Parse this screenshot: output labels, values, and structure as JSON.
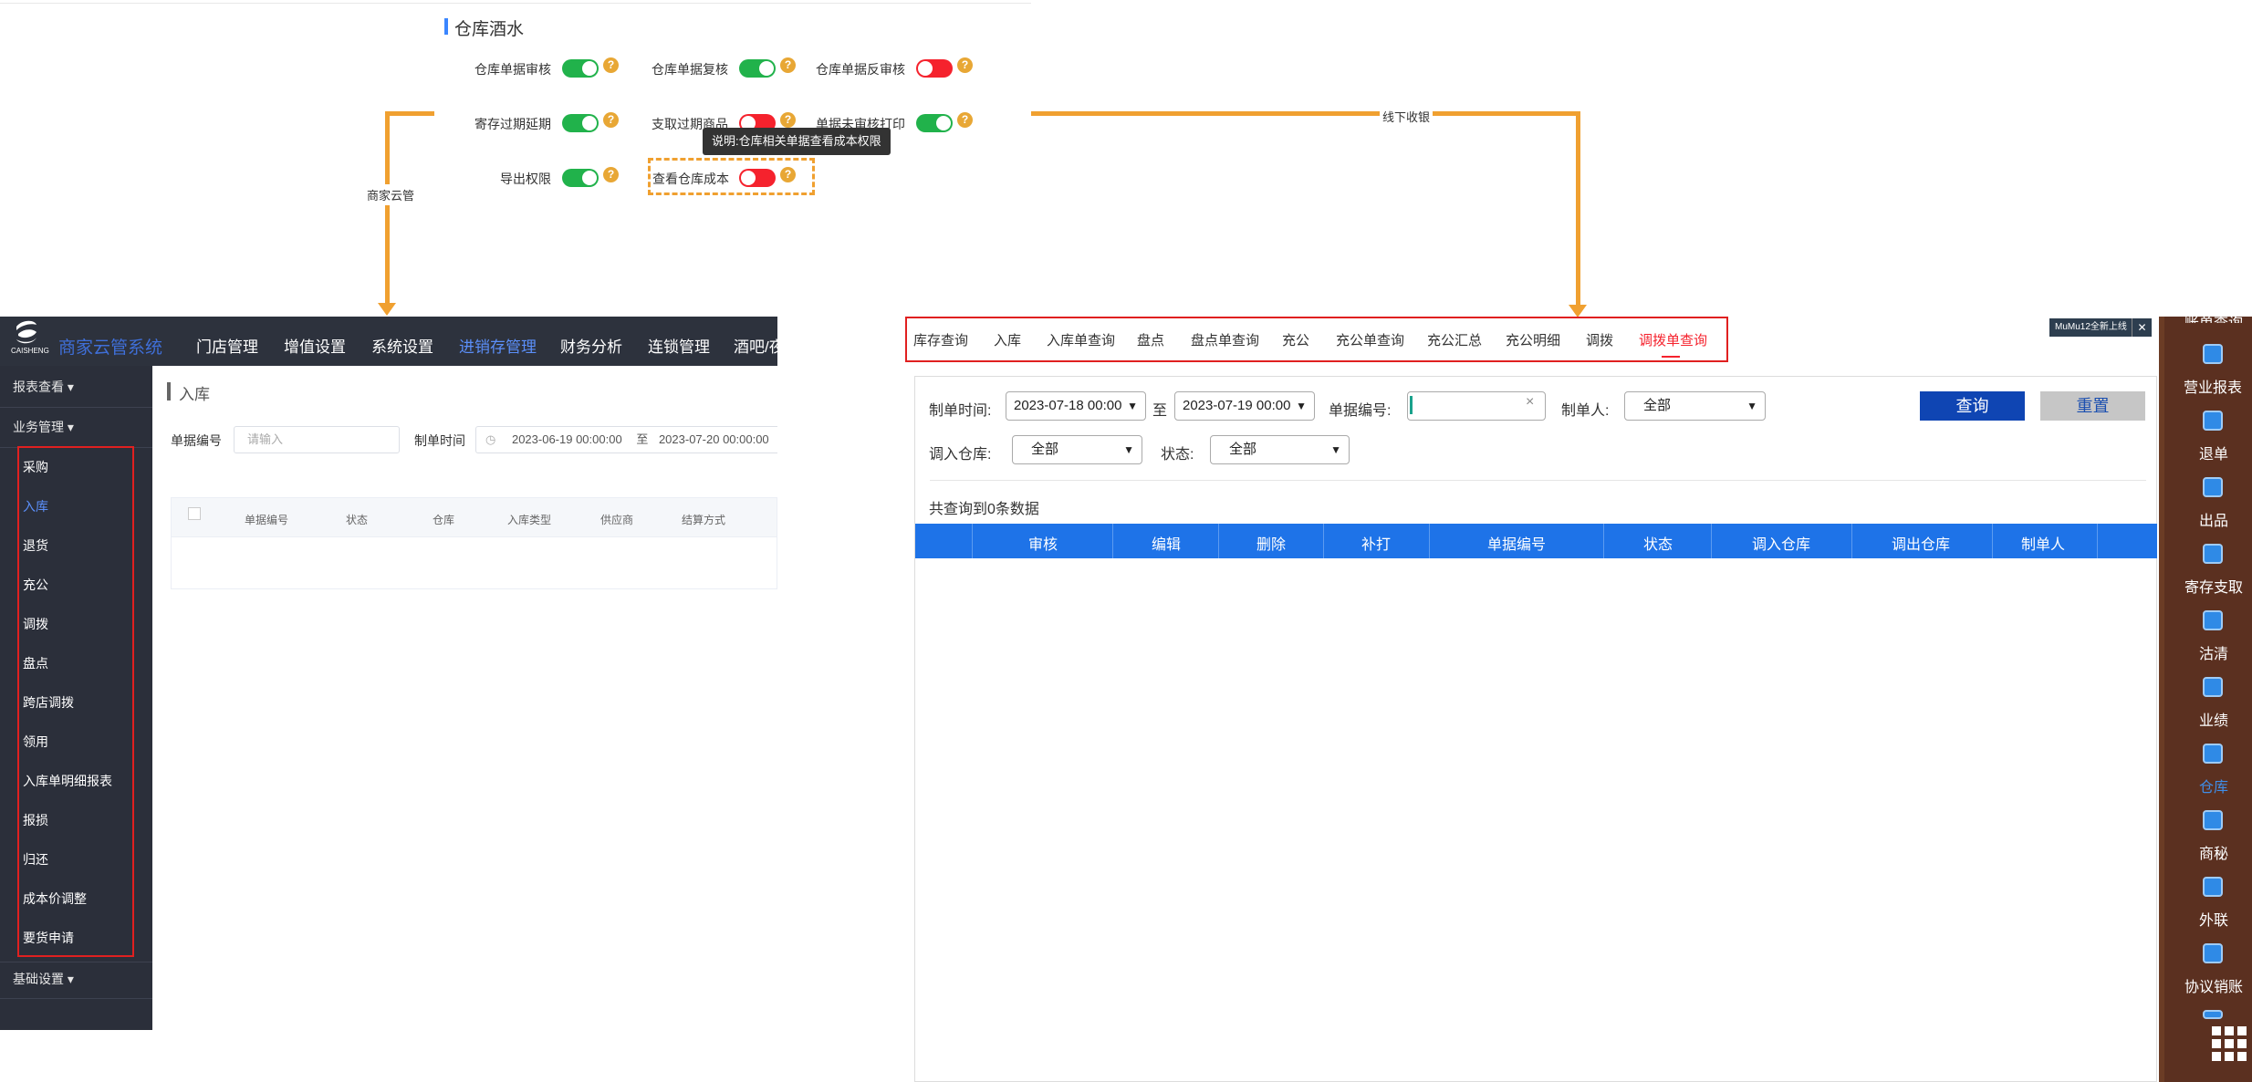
{
  "settings": {
    "title": "仓库酒水",
    "rows": [
      [
        {
          "label": "仓库单据审核",
          "on": true
        },
        {
          "label": "仓库单据复核",
          "on": true
        },
        {
          "label": "仓库单据反审核",
          "on": false
        }
      ],
      [
        {
          "label": "寄存过期延期",
          "on": true
        },
        {
          "label": "支取过期商品",
          "on": false
        },
        {
          "label": "单据未审核打印",
          "on": true
        }
      ],
      [
        {
          "label": "导出权限",
          "on": true
        },
        {
          "label": "查看仓库成本",
          "on": false
        }
      ]
    ],
    "tooltip": "说明:仓库相关单据查看成本权限",
    "help_glyph": "?"
  },
  "flow": {
    "left_label": "商家云管",
    "right_label": "线下收银",
    "accent_color": "#f0a030"
  },
  "left_app": {
    "logo_text": "商家云管系统",
    "logo_sub": "CAISHENG",
    "nav": [
      "门店管理",
      "增值设置",
      "系统设置",
      "进销存管理",
      "财务分析",
      "连锁管理",
      "酒吧/夜"
    ],
    "nav_active": "进销存管理",
    "sidebar_groups": {
      "reports": "报表查看",
      "business": "业务管理",
      "basic": "基础设置"
    },
    "sidebar_items": [
      "采购",
      "入库",
      "退货",
      "充公",
      "调拨",
      "盘点",
      "跨店调拨",
      "领用",
      "入库单明细报表",
      "报损",
      "归还",
      "成本价调整",
      "要货申请"
    ],
    "sidebar_active": "入库",
    "page_title": "入库",
    "filter": {
      "code_label": "单据编号",
      "code_placeholder": "请输入",
      "time_label": "制单时间",
      "start": "2023-06-19 00:00:00",
      "sep": "至",
      "end": "2023-07-20 00:00:00"
    },
    "columns": [
      "单据编号",
      "状态",
      "仓库",
      "入库类型",
      "供应商",
      "结算方式"
    ]
  },
  "right_app": {
    "tabs": [
      "库存查询",
      "入库",
      "入库单查询",
      "盘点",
      "盘点单查询",
      "充公",
      "充公单查询",
      "充公汇总",
      "充公明细",
      "调拨",
      "调拨单查询"
    ],
    "tab_active": "调拨单查询",
    "filters": {
      "time_label": "制单时间:",
      "start": "2023-07-18 00:00",
      "sep": "至",
      "end": "2023-07-19 00:00",
      "code_label": "单据编号:",
      "maker_label": "制单人:",
      "maker_value": "全部",
      "in_wh_label": "调入仓库:",
      "in_wh_value": "全部",
      "status_label": "状态:",
      "status_value": "全部"
    },
    "buttons": {
      "query": "查询",
      "reset": "重置"
    },
    "result_text": "共查询到0条数据",
    "columns": [
      "审核",
      "编辑",
      "删除",
      "补打",
      "单据编号",
      "状态",
      "调入仓库",
      "调出仓库",
      "制单人"
    ],
    "header_color": "#1e73e8"
  },
  "dock": {
    "top_partial": "账单查询",
    "items": [
      "营业报表",
      "退单",
      "出品",
      "寄存支取",
      "沽清",
      "业绩",
      "仓库",
      "商秘",
      "外联",
      "协议销账"
    ],
    "active": "仓库",
    "notice": "MuMu12全新上线"
  }
}
